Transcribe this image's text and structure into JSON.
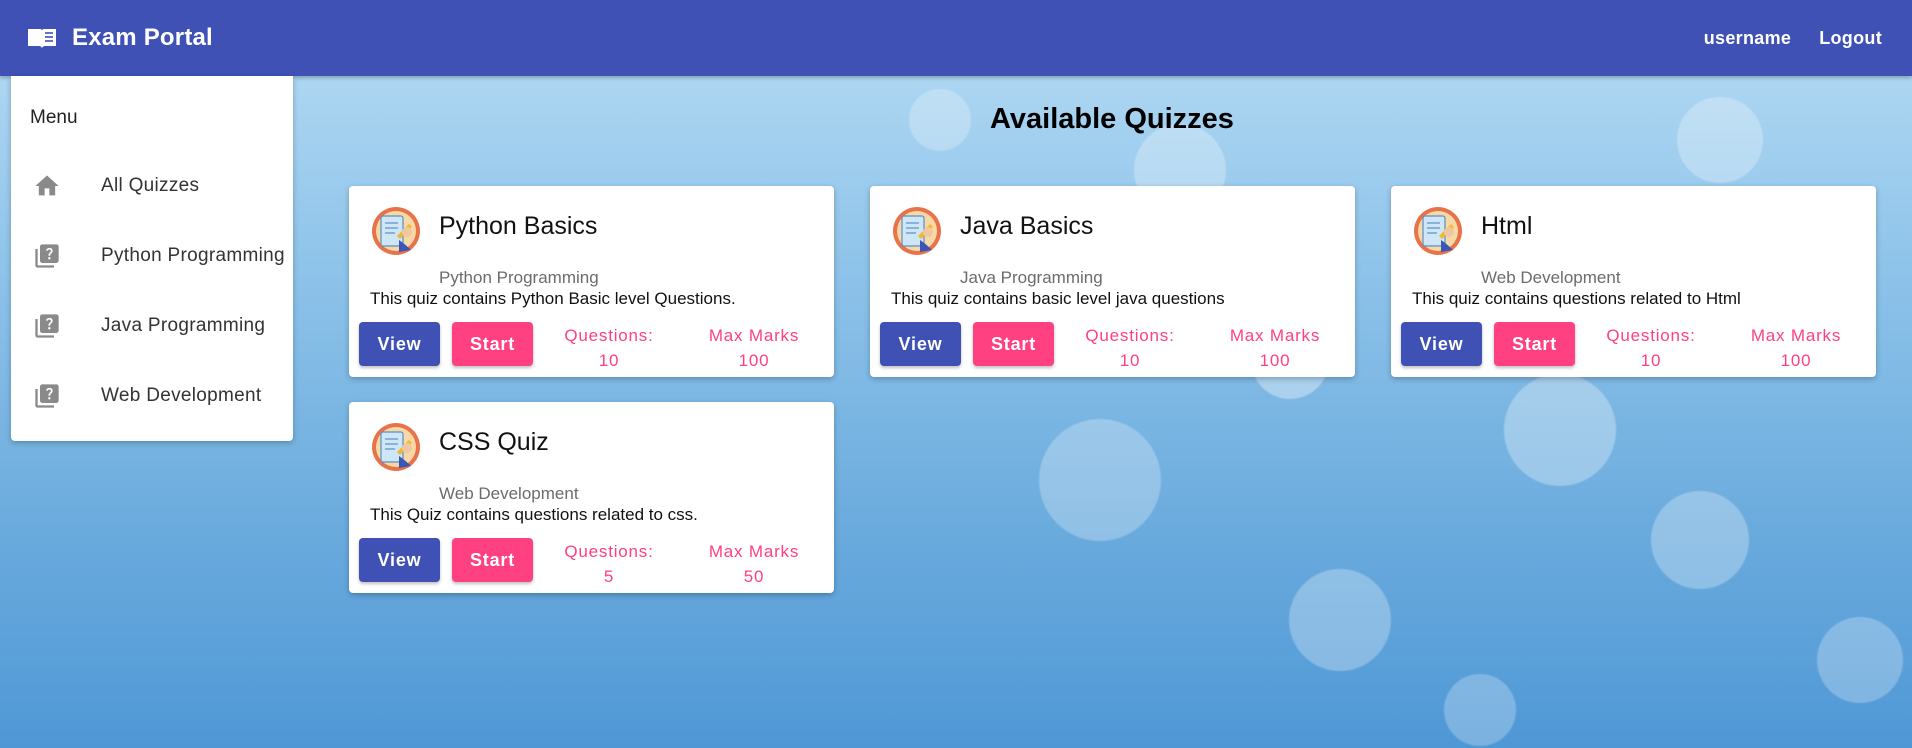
{
  "app": {
    "title": "Exam Portal",
    "logo_icon": "book-icon"
  },
  "topbar": {
    "username": "username",
    "logout_label": "Logout"
  },
  "menu": {
    "heading": "Menu",
    "items": [
      {
        "label": "All Quizzes",
        "icon": "home-icon"
      },
      {
        "label": "Python Programming",
        "icon": "quiz-icon"
      },
      {
        "label": "Java Programming",
        "icon": "quiz-icon"
      },
      {
        "label": "Web Development",
        "icon": "quiz-icon"
      }
    ]
  },
  "main": {
    "title": "Available Quizzes"
  },
  "quizzes": [
    {
      "title": "Python Basics",
      "category": "Python Programming",
      "description": "This quiz contains Python Basic level Questions.",
      "questions_label": "Questions:",
      "questions": "10",
      "marks_label": "Max Marks",
      "marks": "100",
      "view_label": "View",
      "start_label": "Start"
    },
    {
      "title": "Java Basics",
      "category": "Java Programming",
      "description": "This quiz contains basic level java questions",
      "questions_label": "Questions:",
      "questions": "10",
      "marks_label": "Max Marks",
      "marks": "100",
      "view_label": "View",
      "start_label": "Start"
    },
    {
      "title": "Html",
      "category": "Web Development",
      "description": "This quiz contains questions related to Html",
      "questions_label": "Questions:",
      "questions": "10",
      "marks_label": "Max Marks",
      "marks": "100",
      "view_label": "View",
      "start_label": "Start"
    },
    {
      "title": "CSS Quiz",
      "category": "Web Development",
      "description": "This Quiz contains questions related to css.",
      "questions_label": "Questions:",
      "questions": "5",
      "marks_label": "Max Marks",
      "marks": "50",
      "view_label": "View",
      "start_label": "Start"
    }
  ],
  "colors": {
    "primary": "#3f51b5",
    "accent": "#ff4081"
  }
}
